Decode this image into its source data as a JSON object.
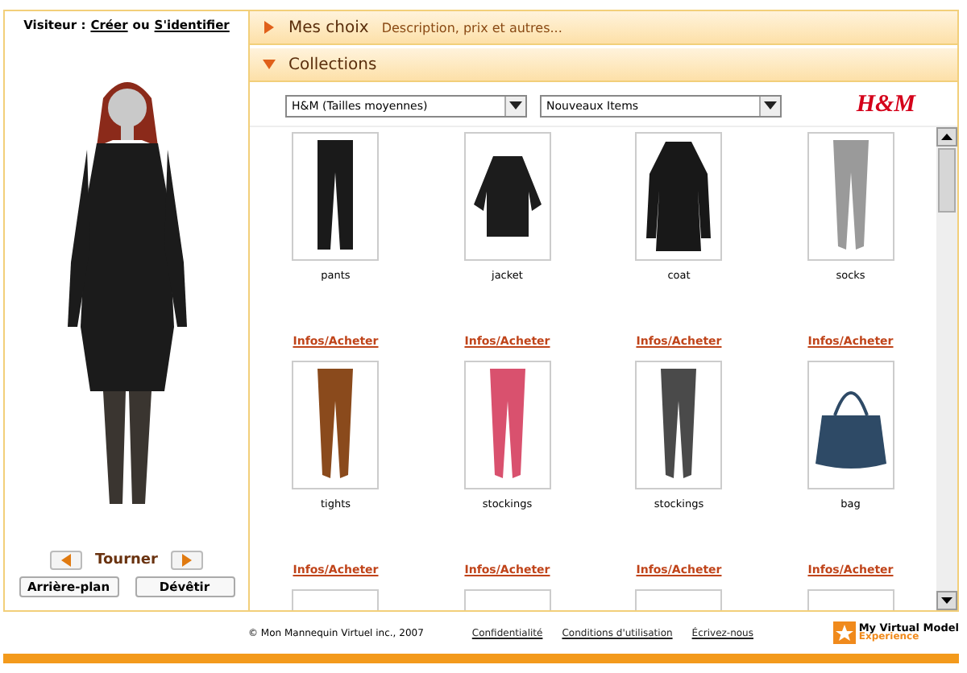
{
  "visitor": {
    "label": "Visiteur :",
    "create_link": "Créer",
    "separator": "ou",
    "login_link": "S'identifier"
  },
  "mannequin": {
    "rotate_label": "Tourner",
    "buttons": [
      "Arrière-plan",
      "Dévêtir"
    ]
  },
  "sections": [
    {
      "title": "Mes choix",
      "subtitle": "Description, prix et autres...",
      "expanded": false
    },
    {
      "title": "Collections",
      "expanded": true
    }
  ],
  "filters": [
    {
      "value": "H&M (Tailles moyennes)"
    },
    {
      "value": "Nouveaux Items"
    }
  ],
  "brand_logo": "H&M",
  "items": [
    {
      "name": "pants",
      "kind": "pants",
      "color": "#1a1a1a",
      "link": "Infos/Acheter"
    },
    {
      "name": "jacket",
      "kind": "top",
      "color": "#1c1c1c",
      "link": "Infos/Acheter"
    },
    {
      "name": "coat",
      "kind": "coat",
      "color": "#181818",
      "link": "Infos/Acheter"
    },
    {
      "name": "socks",
      "kind": "legwear",
      "color": "#9a9a9a",
      "link": "Infos/Acheter"
    },
    {
      "name": "tights",
      "kind": "legwear",
      "color": "#8a4a1c",
      "link": "Infos/Acheter"
    },
    {
      "name": "stockings",
      "kind": "legwear",
      "color": "#d9516e",
      "link": "Infos/Acheter"
    },
    {
      "name": "stockings",
      "kind": "legwear",
      "color": "#4a4a4a",
      "link": "Infos/Acheter"
    },
    {
      "name": "bag",
      "kind": "bag",
      "color": "#2e4a66",
      "link": "Infos/Acheter"
    },
    {
      "kind": "empty"
    },
    {
      "kind": "empty"
    },
    {
      "kind": "empty"
    },
    {
      "kind": "empty"
    }
  ],
  "footer": {
    "copyright": "© Mon Mannequin Virtuel inc., 2007",
    "links": [
      "Confidentialité",
      "Conditions d'utilisation",
      "Écrivez-nous"
    ],
    "brand": "My Virtual Model",
    "brand_sub": "Experience"
  }
}
